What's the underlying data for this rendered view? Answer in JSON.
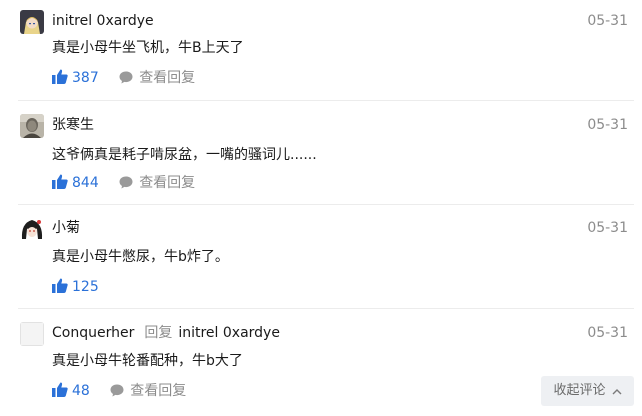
{
  "comments": [
    {
      "author": "initrel 0xardye",
      "date": "05-31",
      "text": "真是小母牛坐飞机，牛B上天了",
      "likes": "387",
      "view_replies": "查看回复",
      "avatar_icon": "anime-character-avatar"
    },
    {
      "author": "张寒生",
      "date": "05-31",
      "text": "这爷俩真是耗子啃尿盆，一嘴的骚词儿......",
      "likes": "844",
      "view_replies": "查看回复",
      "avatar_icon": "photo-portrait-avatar"
    },
    {
      "author": "小菊",
      "date": "05-31",
      "text": "真是小母牛憋尿，牛b炸了。",
      "likes": "125",
      "avatar_icon": "anime-girl-avatar"
    },
    {
      "author": "Conquerher",
      "reply_word": "回复",
      "reply_to": "initrel 0xardye",
      "date": "05-31",
      "text": "真是小母牛轮番配种，牛b大了",
      "likes": "48",
      "view_replies": "查看回复",
      "avatar_icon": "default-blank-avatar"
    }
  ],
  "footer": {
    "collapse_label": "收起评论"
  },
  "colors": {
    "accent": "#2b71d8",
    "muted": "#8c8c8c",
    "button_bg": "#eef0f3"
  }
}
